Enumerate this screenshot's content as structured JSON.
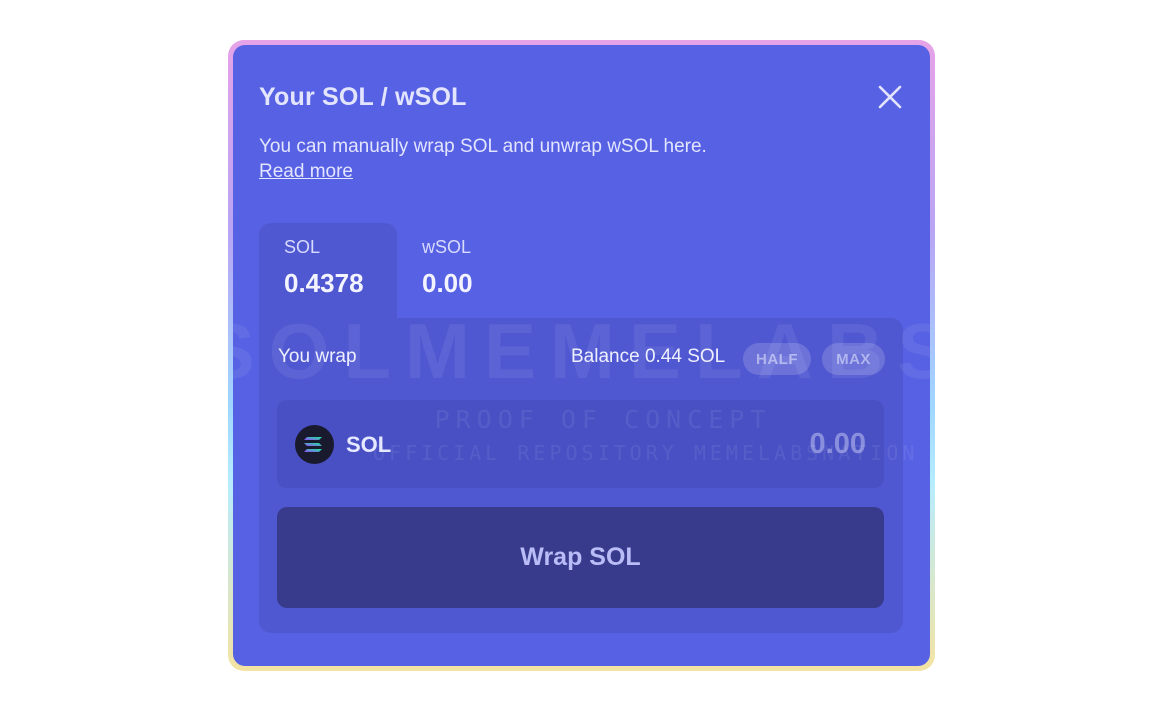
{
  "modal": {
    "title": "Your SOL / wSOL",
    "description": "You can manually wrap SOL and unwrap wSOL here.",
    "read_more": "Read more"
  },
  "tabs": [
    {
      "label": "SOL",
      "value": "0.4378",
      "active": true
    },
    {
      "label": "wSOL",
      "value": "0.00",
      "active": false
    }
  ],
  "wrap_panel": {
    "label": "You wrap",
    "balance": "Balance 0.44 SOL",
    "half_label": "HALF",
    "max_label": "MAX",
    "token_name": "SOL",
    "token_icon": "solana-icon",
    "amount_placeholder": "0.00",
    "button_label": "Wrap SOL"
  },
  "watermark": {
    "big": "SOLMEMELABS",
    "line1": "PROOF OF CONCEPT",
    "line2": "OFFICIAL REPOSITORY MEMELABSNATION"
  },
  "colors": {
    "modal_bg": "#5761e3",
    "panel_bg": "#5058d1",
    "input_bg": "#4850c4",
    "button_bg": "#383b8c",
    "text": "#e3e5ff"
  }
}
